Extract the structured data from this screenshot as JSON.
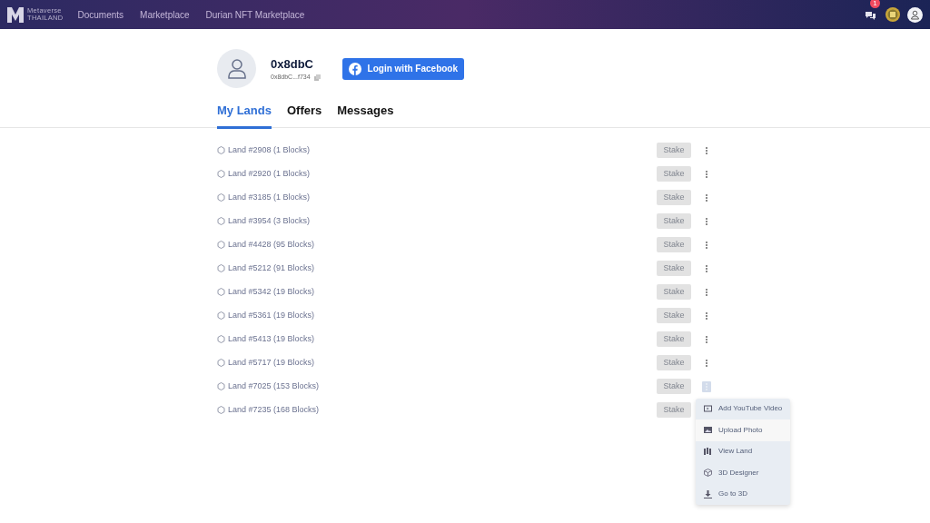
{
  "navbar": {
    "logo": {
      "title": "Metaverse",
      "subtitle": "THAILAND"
    },
    "links": [
      "Documents",
      "Marketplace",
      "Durian NFT Marketplace"
    ],
    "notification_count": "1"
  },
  "profile": {
    "name": "0x8dbC",
    "address": "0x8dbC...f734",
    "facebook_button": "Login with Facebook"
  },
  "tabs": [
    {
      "label": "My Lands",
      "selected": true
    },
    {
      "label": "Offers",
      "selected": false
    },
    {
      "label": "Messages",
      "selected": false
    }
  ],
  "lands": [
    {
      "label": "Land #2908 (1 Blocks)",
      "button": "Stake",
      "menu_open": false
    },
    {
      "label": "Land #2920 (1 Blocks)",
      "button": "Stake",
      "menu_open": false
    },
    {
      "label": "Land #3185 (1 Blocks)",
      "button": "Stake",
      "menu_open": false
    },
    {
      "label": "Land #3954 (3 Blocks)",
      "button": "Stake",
      "menu_open": false
    },
    {
      "label": "Land #4428 (95 Blocks)",
      "button": "Stake",
      "menu_open": false
    },
    {
      "label": "Land #5212 (91 Blocks)",
      "button": "Stake",
      "menu_open": false
    },
    {
      "label": "Land #5342 (19 Blocks)",
      "button": "Stake",
      "menu_open": false
    },
    {
      "label": "Land #5361 (19 Blocks)",
      "button": "Stake",
      "menu_open": false
    },
    {
      "label": "Land #5413 (19 Blocks)",
      "button": "Stake",
      "menu_open": false
    },
    {
      "label": "Land #5717 (19 Blocks)",
      "button": "Stake",
      "menu_open": false
    },
    {
      "label": "Land #7025 (153 Blocks)",
      "button": "Stake",
      "menu_open": true
    },
    {
      "label": "Land #7235 (168 Blocks)",
      "button": "Stake",
      "menu_open": false
    }
  ],
  "menu": [
    {
      "kind": "video",
      "label": "Add YouTube Video",
      "selected": false
    },
    {
      "kind": "photo",
      "label": "Upload Photo",
      "selected": true
    },
    {
      "kind": "view",
      "label": "View Land",
      "selected": false
    },
    {
      "kind": "cube",
      "label": "3D Designer",
      "selected": false
    },
    {
      "kind": "download",
      "label": "Go to 3D",
      "selected": false
    }
  ]
}
